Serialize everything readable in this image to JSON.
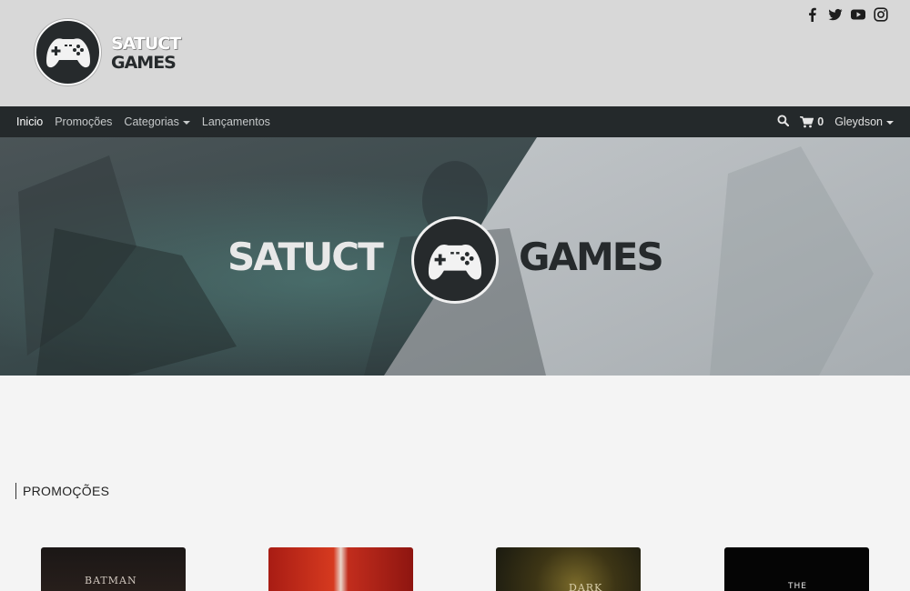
{
  "brand": {
    "line1": "SATUCT",
    "line2": "GAMES"
  },
  "social": [
    {
      "name": "facebook-icon"
    },
    {
      "name": "twitter-icon"
    },
    {
      "name": "youtube-icon"
    },
    {
      "name": "instagram-icon"
    }
  ],
  "nav": {
    "items": [
      "Inicio",
      "Promoções",
      "Categorias",
      "Lançamentos"
    ],
    "cart_count": "0",
    "user": "Gleydson"
  },
  "hero": {
    "left_word": "SATUCT",
    "right_word": "GAMES"
  },
  "section": {
    "title": "PROMOÇÕES"
  },
  "cards": [
    {
      "title": "BATMAN"
    },
    {
      "title": ""
    },
    {
      "title": "DARK"
    },
    {
      "title": "THE"
    }
  ],
  "colors": {
    "header_bg": "#d8d8d8",
    "nav_bg": "#24292b",
    "badge_bg": "#262a2c",
    "page_bg": "#f4f4f4"
  }
}
